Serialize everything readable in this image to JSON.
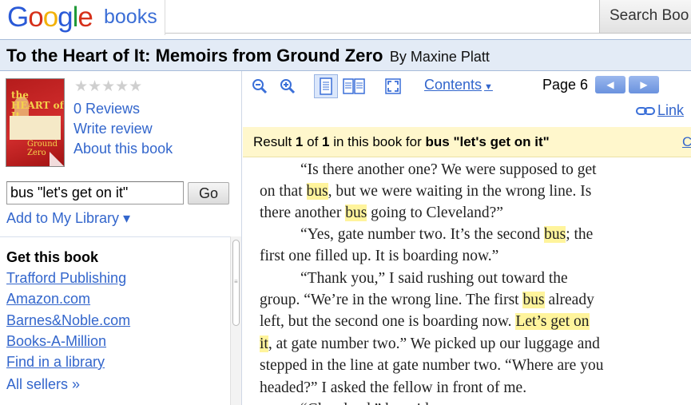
{
  "header": {
    "logo_letters": [
      "G",
      "o",
      "o",
      "g",
      "l",
      "e"
    ],
    "logo_suffix": "books",
    "search_value": "",
    "search_button": "Search Boo"
  },
  "book": {
    "title": "To the Heart of It: Memoirs from Ground Zero",
    "author": "By Maxine Platt",
    "cover_text_top": "the HEART of It",
    "cover_text_bottom": "Ground Zero"
  },
  "sidebar": {
    "stars": "★★★★★",
    "rating_stars_filled": 0,
    "reviews": "0 Reviews",
    "write_review": "Write review",
    "about": "About this book",
    "query_value": "bus \"let's get on it\"",
    "go_label": "Go",
    "add_library": "Add to My Library ▾",
    "get_title": "Get this book",
    "sellers": [
      "Trafford Publishing",
      "Amazon.com",
      "Barnes&Noble.com",
      "Books-A-Million",
      "Find in a library"
    ],
    "all_sellers": "All sellers »"
  },
  "toolbar": {
    "icons": [
      "zoom-out-icon",
      "zoom-in-icon",
      "single-page-view-icon",
      "two-page-view-icon",
      "fullscreen-icon"
    ],
    "contents_label": "Contents",
    "page_label": "Page 6",
    "prev_glyph": "◀",
    "next_glyph": "▶",
    "link_label": "Link"
  },
  "result": {
    "prefix": "Result ",
    "index": "1",
    "of": " of ",
    "total": "1",
    "middle": " in this book for ",
    "query": "bus \"let's get on it\"",
    "clear_partial": "C"
  },
  "page_text": {
    "lines": [
      [
        {
          "t": "“Is there another one?  We were supposed to get",
          "h": false
        }
      ],
      [
        {
          "t": "on that ",
          "h": false
        },
        {
          "t": "bus",
          "h": true
        },
        {
          "t": ", but we were waiting in the wrong line.  Is",
          "h": false
        }
      ],
      [
        {
          "t": "there another ",
          "h": false
        },
        {
          "t": "bus",
          "h": true
        },
        {
          "t": " going to Cleveland?”",
          "h": false
        }
      ],
      [
        {
          "t": "“Yes, gate number two.  It’s the second ",
          "h": false
        },
        {
          "t": "bus",
          "h": true
        },
        {
          "t": "; the",
          "h": false
        }
      ],
      [
        {
          "t": "first one filled up.  It is boarding now.”",
          "h": false
        }
      ],
      [
        {
          "t": "“Thank you,” I said rushing out toward the",
          "h": false
        }
      ],
      [
        {
          "t": "group.  “We’re in the wrong line.  The first ",
          "h": false
        },
        {
          "t": "bus",
          "h": true
        },
        {
          "t": " already",
          "h": false
        }
      ],
      [
        {
          "t": "left, but the second one is boarding now.  ",
          "h": false
        },
        {
          "t": "Let’s get on",
          "h": true
        }
      ],
      [
        {
          "t": "it",
          "h": true
        },
        {
          "t": ", at gate number two.”  We picked up our luggage and",
          "h": false
        }
      ],
      [
        {
          "t": "stepped in the line at gate number two.  “Where are you",
          "h": false
        }
      ],
      [
        {
          "t": "headed?” I asked the fellow in front of me.",
          "h": false
        }
      ],
      [
        {
          "t": "“Cleveland,” he said.",
          "h": false
        }
      ]
    ]
  },
  "colors": {
    "link": "#3366cc",
    "highlight": "#fff49c",
    "result_bg": "#fff7cc",
    "title_bg": "#e3ebf6"
  }
}
